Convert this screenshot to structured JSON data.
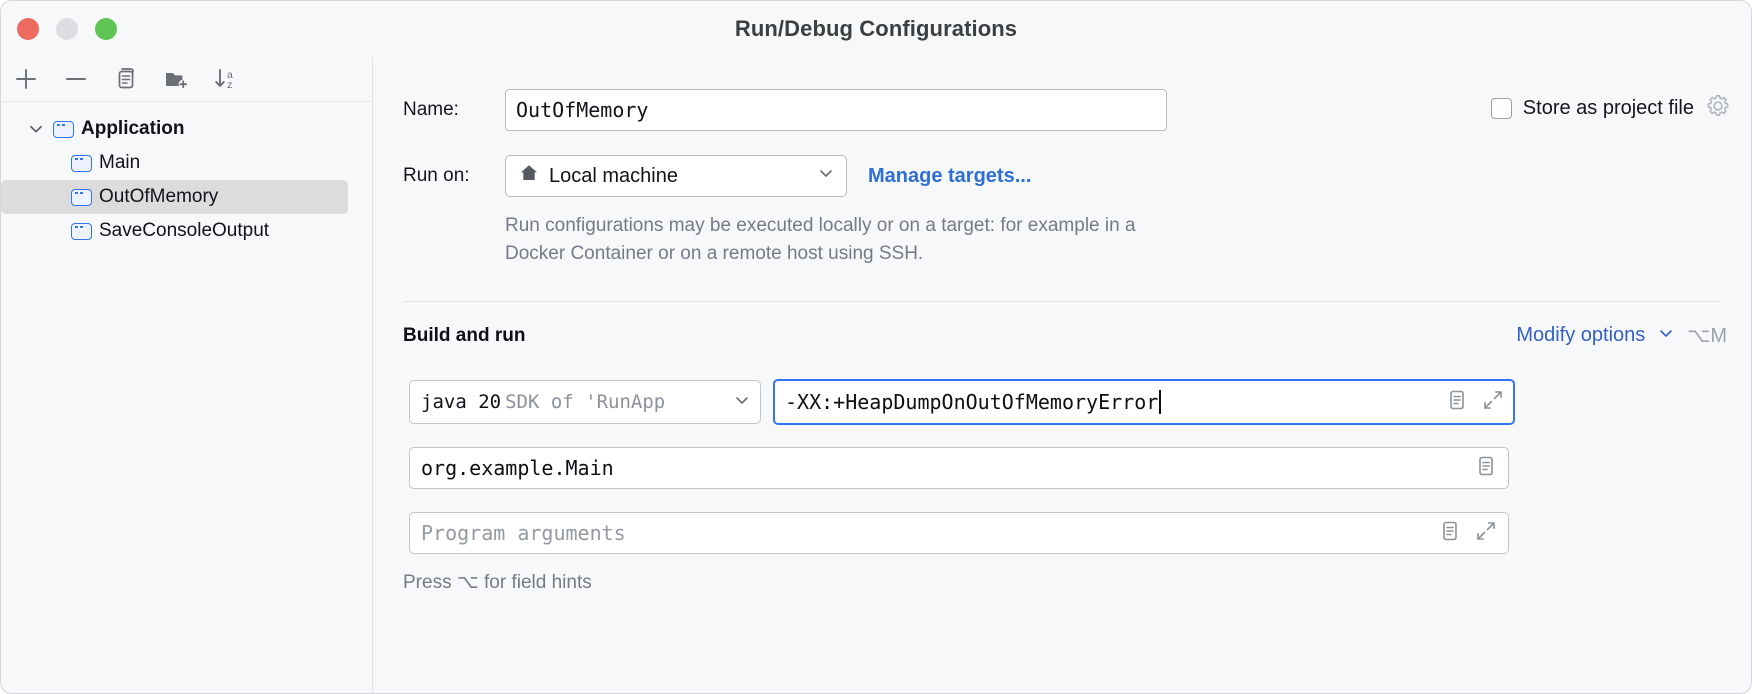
{
  "window": {
    "title": "Run/Debug Configurations",
    "traffic_lights": [
      "close",
      "minimize",
      "zoom"
    ],
    "colors": {
      "close": "#ed6a5e",
      "minimize": "#dcdde0",
      "zoom": "#60c454",
      "accent_blue": "#3574f0",
      "link_blue": "#2f6fd4",
      "background": "#f7f8fa",
      "selection": "#dcdcdd"
    }
  },
  "sidebar": {
    "toolbar": [
      {
        "name": "add-configuration-button",
        "icon": "plus-icon"
      },
      {
        "name": "remove-configuration-button",
        "icon": "minus-icon"
      },
      {
        "name": "copy-configuration-button",
        "icon": "copy-icon"
      },
      {
        "name": "new-folder-button",
        "icon": "folder-add-icon"
      },
      {
        "name": "sort-configurations-button",
        "icon": "sort-alphabetically-icon"
      }
    ],
    "tree": [
      {
        "label": "Application",
        "type": "group",
        "expanded": true,
        "selected": false,
        "icon": "run-configuration-icon"
      },
      {
        "label": "Main",
        "type": "item",
        "selected": false,
        "icon": "run-configuration-icon"
      },
      {
        "label": "OutOfMemory",
        "type": "item",
        "selected": true,
        "icon": "run-configuration-icon"
      },
      {
        "label": "SaveConsoleOutput",
        "type": "item",
        "selected": false,
        "icon": "run-configuration-icon"
      }
    ]
  },
  "form": {
    "name_label": "Name:",
    "name_value": "OutOfMemory",
    "store_as_project_file_label": "Store as project file",
    "store_as_project_file_checked": false,
    "run_on_label": "Run on:",
    "run_on_value": "Local machine",
    "run_on_icon": "home-icon",
    "manage_targets_link": "Manage targets...",
    "targets_hint": "Run configurations may be executed locally or on a target: for example in a Docker Container or on a remote host using SSH."
  },
  "build_and_run": {
    "section_title": "Build and run",
    "modify_options_label": "Modify options",
    "modify_options_shortcut": "⌥M",
    "jdk_main": "java 20",
    "jdk_sub": "SDK of 'RunApp",
    "vm_options_value": "-XX:+HeapDumpOnOutOfMemoryError",
    "main_class_value": "org.example.Main",
    "program_arguments_placeholder": "Program arguments",
    "field_hint": "Press ⌥ for field hints"
  }
}
